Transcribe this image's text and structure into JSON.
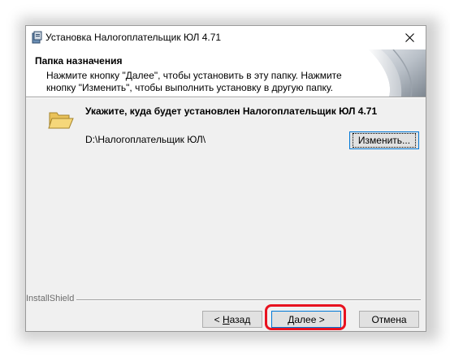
{
  "window": {
    "title": "Установка Налогоплательщик ЮЛ 4.71",
    "close_symbol": "✕"
  },
  "header": {
    "title": "Папка назначения",
    "description": "Нажмите кнопку \"Далее\", чтобы установить в эту папку. Нажмите кнопку \"Изменить\", чтобы выполнить установку в другую папку."
  },
  "main": {
    "instruction": "Укажите, куда будет установлен Налогоплательщик ЮЛ 4.71",
    "install_path": "D:\\Налогоплательщик ЮЛ\\",
    "change_button": "Изменить..."
  },
  "footer": {
    "brand": "InstallShield",
    "back_prefix": "< ",
    "back_hotkey": "Н",
    "back_rest": "азад",
    "next_hotkey": "Д",
    "next_rest": "алее >",
    "cancel_label": "Отмена"
  },
  "icons": {
    "app": "installer-app-icon",
    "folder": "folder-open-icon",
    "close": "close-icon"
  },
  "colors": {
    "highlight": "#e8121f",
    "focus_border": "#0078d7",
    "folder_fill": "#f5d77a"
  }
}
